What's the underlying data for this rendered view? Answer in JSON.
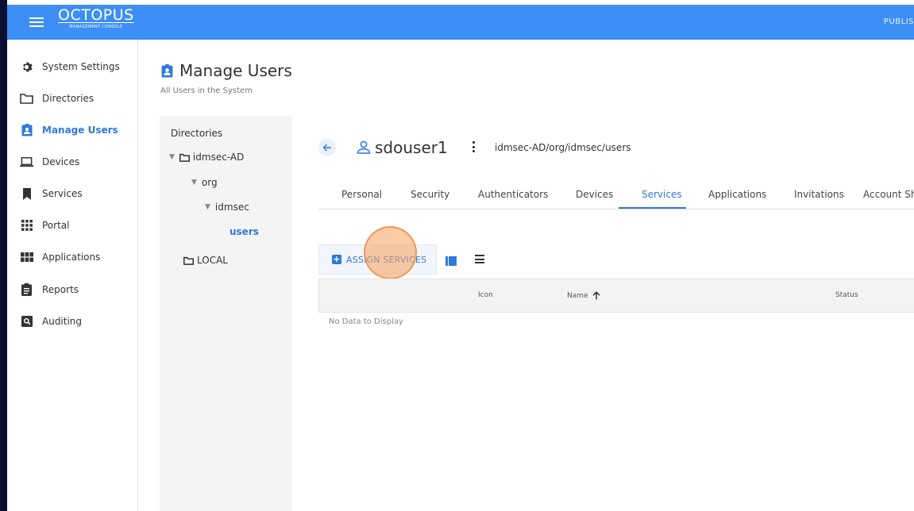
{
  "app": {
    "logo_name": "OCTOPUS",
    "logo_sub": "MANAGEMENT CONSOLE",
    "top_right_text": "PUBLIS",
    "accent": "#3d8ff5",
    "active_color": "#2f7ad8"
  },
  "sidebar": {
    "items": [
      {
        "label": "System Settings",
        "icon": "gear-icon"
      },
      {
        "label": "Directories",
        "icon": "folder-icon"
      },
      {
        "label": "Manage Users",
        "icon": "user-badge-icon",
        "active": true
      },
      {
        "label": "Devices",
        "icon": "laptop-icon"
      },
      {
        "label": "Services",
        "icon": "bookmark-icon"
      },
      {
        "label": "Portal",
        "icon": "grid-icon"
      },
      {
        "label": "Applications",
        "icon": "apps-icon"
      },
      {
        "label": "Reports",
        "icon": "clipboard-icon"
      },
      {
        "label": "Auditing",
        "icon": "search-box-icon"
      }
    ]
  },
  "page": {
    "title": "Manage Users",
    "subtitle": "All Users in the System"
  },
  "tree": {
    "title": "Directories",
    "nodes": {
      "idmsec_ad": "idmsec-AD",
      "org": "org",
      "idmsec": "idmsec",
      "users": "users",
      "local": "LOCAL"
    }
  },
  "user": {
    "name": "sdouser1",
    "path": "idmsec-AD/org/idmsec/users"
  },
  "tabs": [
    {
      "label": "Personal"
    },
    {
      "label": "Security"
    },
    {
      "label": "Authenticators"
    },
    {
      "label": "Devices"
    },
    {
      "label": "Services",
      "active": true
    },
    {
      "label": "Applications"
    },
    {
      "label": "Invitations"
    },
    {
      "label": "Account Sh"
    }
  ],
  "toolbar": {
    "assign_label": "ASSIGN SERVICES"
  },
  "table": {
    "columns": {
      "icon": "Icon",
      "name": "Name",
      "status": "Status"
    },
    "empty_text": "No Data to Display"
  }
}
